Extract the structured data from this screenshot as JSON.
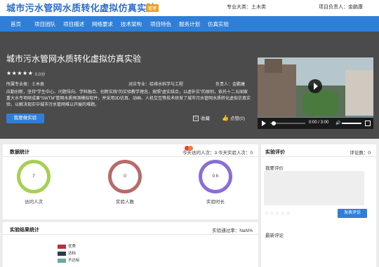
{
  "header": {
    "title": "城市污水管网水质转化虚拟仿真实验",
    "admin_tag": "管理",
    "major": "专业大类：土木类",
    "leader": "项目负责人：金鹏康"
  },
  "nav": {
    "items": [
      "首页",
      "项目团队",
      "项目描述",
      "网络要求",
      "技术架构",
      "项目特色",
      "服务计划",
      "仿真实验"
    ]
  },
  "hero": {
    "title": "城市污水管网水质转化虚拟仿真实验",
    "stars": "★★★★★",
    "score": "0.0分",
    "major": "所属专业类：土木类",
    "related": "对应专业：给排水科学与工程",
    "leader": "负责人：金鹏康",
    "description": "应勤创新，坚持“学生中心、问题导向、学科融合、创新实践”的实验教学理念，按照“虚实结合，以虚补实”的原则，依托十二五国家重大水专项研成果“SWTM”管网水质预测模拟软件，并采用3D仿真、动画、人机交互等技术研发了城市污水管网水质转化虚拟仿真实验，以解决现实中城市污水管网难以开展的难题。",
    "exp_button": "我要做实验",
    "fav": "收藏",
    "like": "点赞(0)"
  },
  "video": {
    "time": "0:00 / 3:00"
  },
  "stats": {
    "title": "数据统计",
    "today": "今天访问人次：3 今天实验人次：0",
    "rings": [
      {
        "value": "7",
        "label": "访问人次",
        "color": "#a6d050"
      },
      {
        "value": "0",
        "label": "实验人数",
        "color": "#b86a6a"
      },
      {
        "value": "0 h",
        "label": "实验时长",
        "color": "#8a6ed6"
      }
    ],
    "dot_colors": [
      "#e84040",
      "#f08030"
    ]
  },
  "results": {
    "title": "实验结果统计",
    "pass_rate": "实验通过率：NaN%",
    "legend": [
      {
        "label": "优秀",
        "color": "#b5333b"
      },
      {
        "label": "达标",
        "color": "#2e3a4a"
      },
      {
        "label": "不达标",
        "color": "#6aa8a8"
      }
    ]
  },
  "review": {
    "title": "实验评价",
    "count": "评论数：0",
    "my_review": "我要评价",
    "stars": "☆☆☆☆☆",
    "submit": "发表评论",
    "latest": "最新评论"
  },
  "colors": {
    "primary": "#2f7fd8",
    "hero_bg": "#4b4b4b"
  }
}
